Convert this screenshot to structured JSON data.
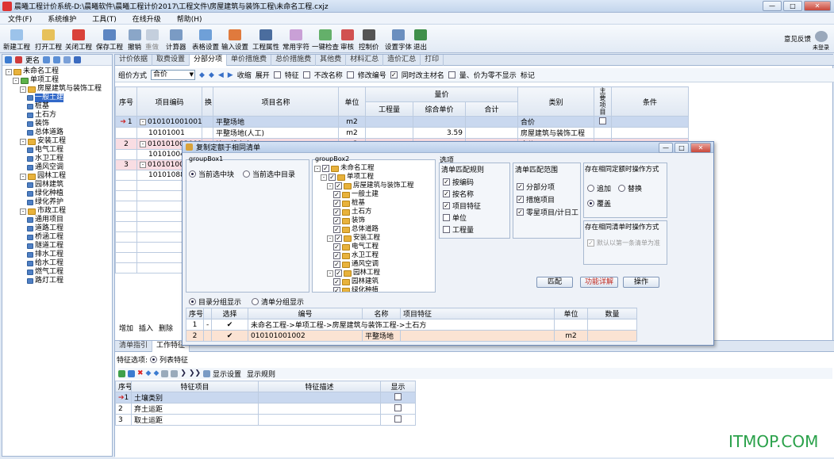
{
  "title": "晨曦工程计价系统-D:\\晨曦软件\\晨曦工程计价2017\\工程文件\\房屋建筑与装饰工程\\未命名工程.cxjz",
  "menu": [
    "文件(F)",
    "系统维护",
    "工具(T)",
    "在线升级",
    "帮助(H)"
  ],
  "toolbar": [
    "新建工程",
    "打开工程",
    "关闭工程",
    "保存工程",
    "撤销",
    "重做",
    "计算器",
    "表格设置",
    "输入设置",
    "工程属性",
    "常用字符",
    "一键检查",
    "审核",
    "控制价",
    "设置字体",
    "退出"
  ],
  "feedback": "意见反馈",
  "user": "未登录",
  "tree_toolbar": "更名",
  "tree": [
    "未命名工程",
    "单项工程",
    "房屋建筑与装饰工程",
    "一般土建",
    "桩基",
    "土石方",
    "装饰",
    "总体道路",
    "安装工程",
    "电气工程",
    "水卫工程",
    "通风空调",
    "园林工程",
    "园林建筑",
    "绿化种植",
    "绿化养护",
    "市政工程",
    "通用项目",
    "道路工程",
    "桥涵工程",
    "隧道工程",
    "排水工程",
    "给水工程",
    "燃气工程",
    "路灯工程"
  ],
  "tabs": [
    "计价依据",
    "取费设置",
    "分部分项",
    "单价措施费",
    "总价措施费",
    "其他费",
    "材料汇总",
    "造价汇总",
    "打印"
  ],
  "filter": {
    "label": "组价方式",
    "value": "合价",
    "shrink": "收缩",
    "expand": "展开",
    "checks": [
      "特征",
      "不改名称",
      "修改编号",
      "同时改主材名",
      "量、价为零不显示"
    ],
    "mark": "标记"
  },
  "grid": {
    "headers": [
      "序号",
      "项目编码",
      "换",
      "项目名称",
      "单位",
      "量价",
      "工程量",
      "综合单价",
      "合计",
      "类别",
      "主要项目",
      "条件"
    ],
    "rows": [
      [
        "1",
        "010101001001",
        "",
        "平整场地",
        "m2",
        "",
        "",
        "",
        "合价",
        ""
      ],
      [
        "",
        "10101001",
        "",
        "平整场地(人工)",
        "m2",
        "",
        "3.59",
        "",
        "房屋建筑与装饰工程",
        ""
      ],
      [
        "2",
        "010101002001",
        "",
        "挖一般土方",
        "m3",
        "",
        "",
        "",
        "合价",
        ""
      ],
      [
        "",
        "10101004",
        "",
        "",
        "",
        "",
        "",
        "",
        "",
        ""
      ],
      [
        "3",
        "010101006001",
        "",
        "",
        "",
        "",
        "",
        "",
        "",
        ""
      ],
      [
        "",
        "10101088",
        "",
        "",
        "",
        "",
        "",
        "",
        "",
        ""
      ]
    ]
  },
  "bottom_tabs": [
    "清单指引",
    "工作特征"
  ],
  "bottom_toolbar": [
    "增加",
    "插入",
    "删除"
  ],
  "feature": {
    "label": "特征选项:",
    "option": "列表特征",
    "show_set": "显示设置",
    "show_rule": "显示规则",
    "headers": [
      "序号",
      "特征项目",
      "特征描述",
      "显示"
    ],
    "rows": [
      [
        "1",
        "土壤类别"
      ],
      [
        "2",
        "弃土运距"
      ],
      [
        "3",
        "取土运距"
      ]
    ]
  },
  "dialog": {
    "title": "复制定额于相同清单",
    "gb1": "groupBox1",
    "r1": "当前选中块",
    "r2": "当前选中目录",
    "gb2": "groupBox2",
    "tree": [
      "未命名工程",
      "单项工程",
      "房屋建筑与装饰工程",
      "一般土建",
      "桩基",
      "土石方",
      "装饰",
      "总体道路",
      "安装工程",
      "电气工程",
      "水卫工程",
      "通风空调",
      "园林工程",
      "园林建筑",
      "绿化种植"
    ],
    "options": "选项",
    "match": "清单匹配规则",
    "match_items": [
      "按编码",
      "按名称",
      "项目特征",
      "单位",
      "工程量"
    ],
    "range": "清单匹配范围",
    "range_items": [
      "分部分项",
      "措施项目",
      "零星项目/计日工"
    ],
    "op": "存在相同定额时操作方式",
    "op_items": [
      "追加",
      "替换",
      "覆盖"
    ],
    "op2": "存在相同清单时操作方式",
    "op2_item": "默认以第一条清单为准",
    "btn_match": "匹配",
    "btn_detail": "功能详解",
    "btn_op": "操作",
    "view1": "目录分组显示",
    "view2": "清单分组显示",
    "list_headers": [
      "序号",
      "选择",
      "编号",
      "名称",
      "项目特征",
      "单位",
      "数量"
    ],
    "list_rows": [
      [
        "1",
        "",
        "未命名工程->单项工程->房屋建筑与装饰工程->土石方",
        "",
        "",
        "",
        ""
      ],
      [
        "2",
        "",
        "010101001002",
        "平整场地",
        "",
        "m2",
        ""
      ]
    ]
  },
  "watermark": "ITMOP.COM"
}
